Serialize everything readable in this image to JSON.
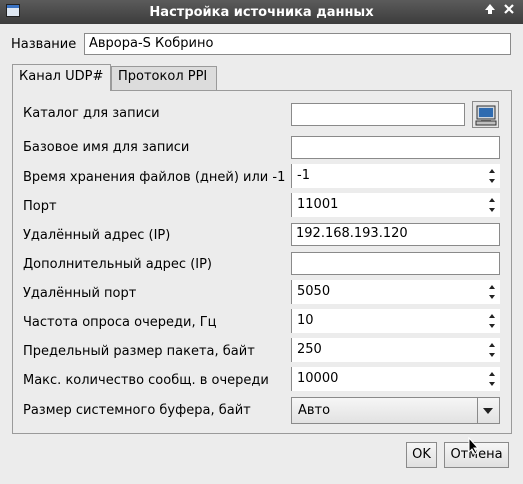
{
  "window": {
    "title": "Настройка источника данных",
    "pin_glyph": "🡅",
    "close_glyph": "✕"
  },
  "name_field": {
    "label": "Название",
    "value": "Аврора-S Кобрино"
  },
  "tabs": [
    {
      "label": "Канал UDP#",
      "active": true
    },
    {
      "label": "Протокол PPI",
      "active": false
    }
  ],
  "fields": {
    "catalog": {
      "label": "Каталог для записи",
      "value": ""
    },
    "base_name": {
      "label": "Базовое имя для записи",
      "value": ""
    },
    "retention": {
      "label": "Время хранения файлов (дней) или -1",
      "value": "-1"
    },
    "port": {
      "label": "Порт",
      "value": "11001"
    },
    "remote_addr": {
      "label": "Удалённый адрес (IP)",
      "value": "192.168.193.120"
    },
    "extra_addr": {
      "label": "Дополнительный адрес (IP)",
      "value": ""
    },
    "remote_port": {
      "label": "Удалённый порт",
      "value": "5050"
    },
    "poll_rate": {
      "label": "Частота опроса очереди, Гц",
      "value": "10"
    },
    "max_packet": {
      "label": "Предельный размер пакета, байт",
      "value": "250"
    },
    "max_queue": {
      "label": "Макс. количество сообщ. в очереди",
      "value": "10000"
    },
    "sys_buffer": {
      "label": "Размер системного буфера, байт",
      "value": "Авто"
    }
  },
  "buttons": {
    "ok": "OK",
    "cancel": "Отмена"
  }
}
